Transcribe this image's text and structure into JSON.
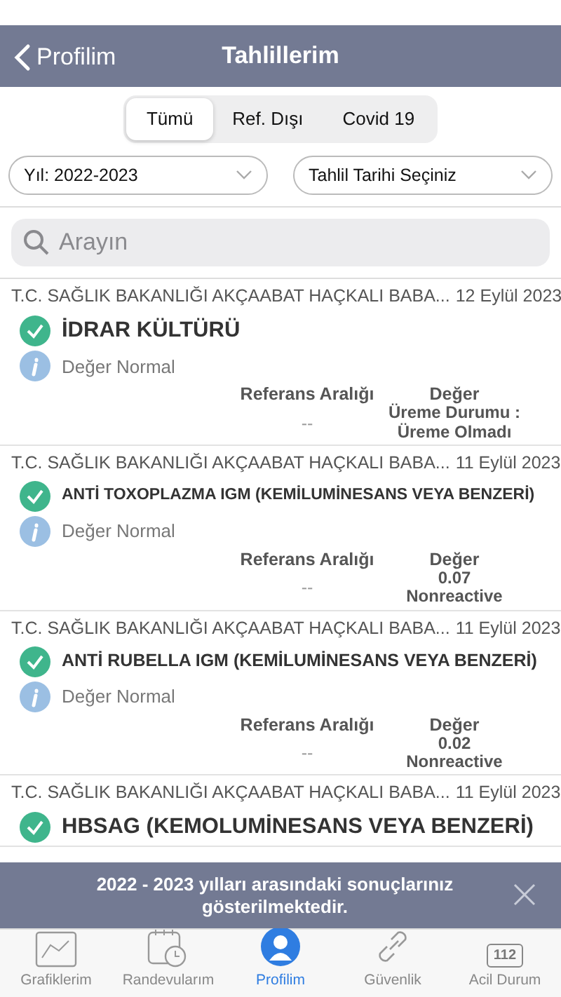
{
  "nav": {
    "back": "Profilim",
    "title": "Tahlillerim"
  },
  "segments": [
    {
      "label": "Tümü",
      "selected": true
    },
    {
      "label": "Ref. Dışı",
      "selected": false
    },
    {
      "label": "Covid 19",
      "selected": false
    }
  ],
  "filters": [
    {
      "label": "Yıl: 2022-2023"
    },
    {
      "label": "Tahlil Tarihi Seçiniz"
    }
  ],
  "search": {
    "placeholder": "Arayın"
  },
  "results": [
    {
      "source": "T.C. SAĞLIK BAKANLIĞI AKÇAABAT HAÇKALI BABA...",
      "date": "12 Eylül 2023",
      "title": "İDRAR KÜLTÜRÜ",
      "note": "Değer Normal",
      "ref_label": "Referans Aralığı",
      "value_label": "Değer",
      "ref": "--",
      "value": [
        "Üreme Durumu :",
        "Üreme Olmadı"
      ]
    },
    {
      "source": "T.C. SAĞLIK BAKANLIĞI AKÇAABAT HAÇKALI BABA...",
      "date": "11 Eylül 2023",
      "title": "ANTİ TOXOPLAZMA IGM (KEMİLUMİNESANS VEYA BENZERİ)",
      "note": "Değer Normal",
      "ref_label": "Referans Aralığı",
      "value_label": "Değer",
      "ref": "--",
      "value": [
        "0.07",
        "Nonreactive"
      ]
    },
    {
      "source": "T.C. SAĞLIK BAKANLIĞI AKÇAABAT HAÇKALI BABA...",
      "date": "11 Eylül 2023",
      "title": "ANTİ RUBELLA IGM (KEMİLUMİNESANS VEYA BENZERİ)",
      "note": "Değer Normal",
      "ref_label": "Referans Aralığı",
      "value_label": "Değer",
      "ref": "--",
      "value": [
        "0.02",
        "Nonreactive"
      ]
    },
    {
      "source": "T.C. SAĞLIK BAKANLIĞI AKÇAABAT HAÇKALI BABA...",
      "date": "11 Eylül 2023",
      "title": "HBSAG (KEMOLUMİNESANS VEYA BENZERİ)"
    }
  ],
  "toast": {
    "message": "2022 - 2023 yılları arasındaki sonuçlarınız gösterilmektedir."
  },
  "tabs": [
    {
      "label": "Grafiklerim",
      "kind": "chart",
      "selected": false
    },
    {
      "label": "Randevularım",
      "kind": "calendar",
      "selected": false
    },
    {
      "label": "Profilim",
      "kind": "person",
      "selected": true
    },
    {
      "label": "Güvenlik",
      "kind": "link",
      "selected": false
    },
    {
      "label": "Acil Durum",
      "kind": "number",
      "badge": "112",
      "selected": false
    }
  ]
}
